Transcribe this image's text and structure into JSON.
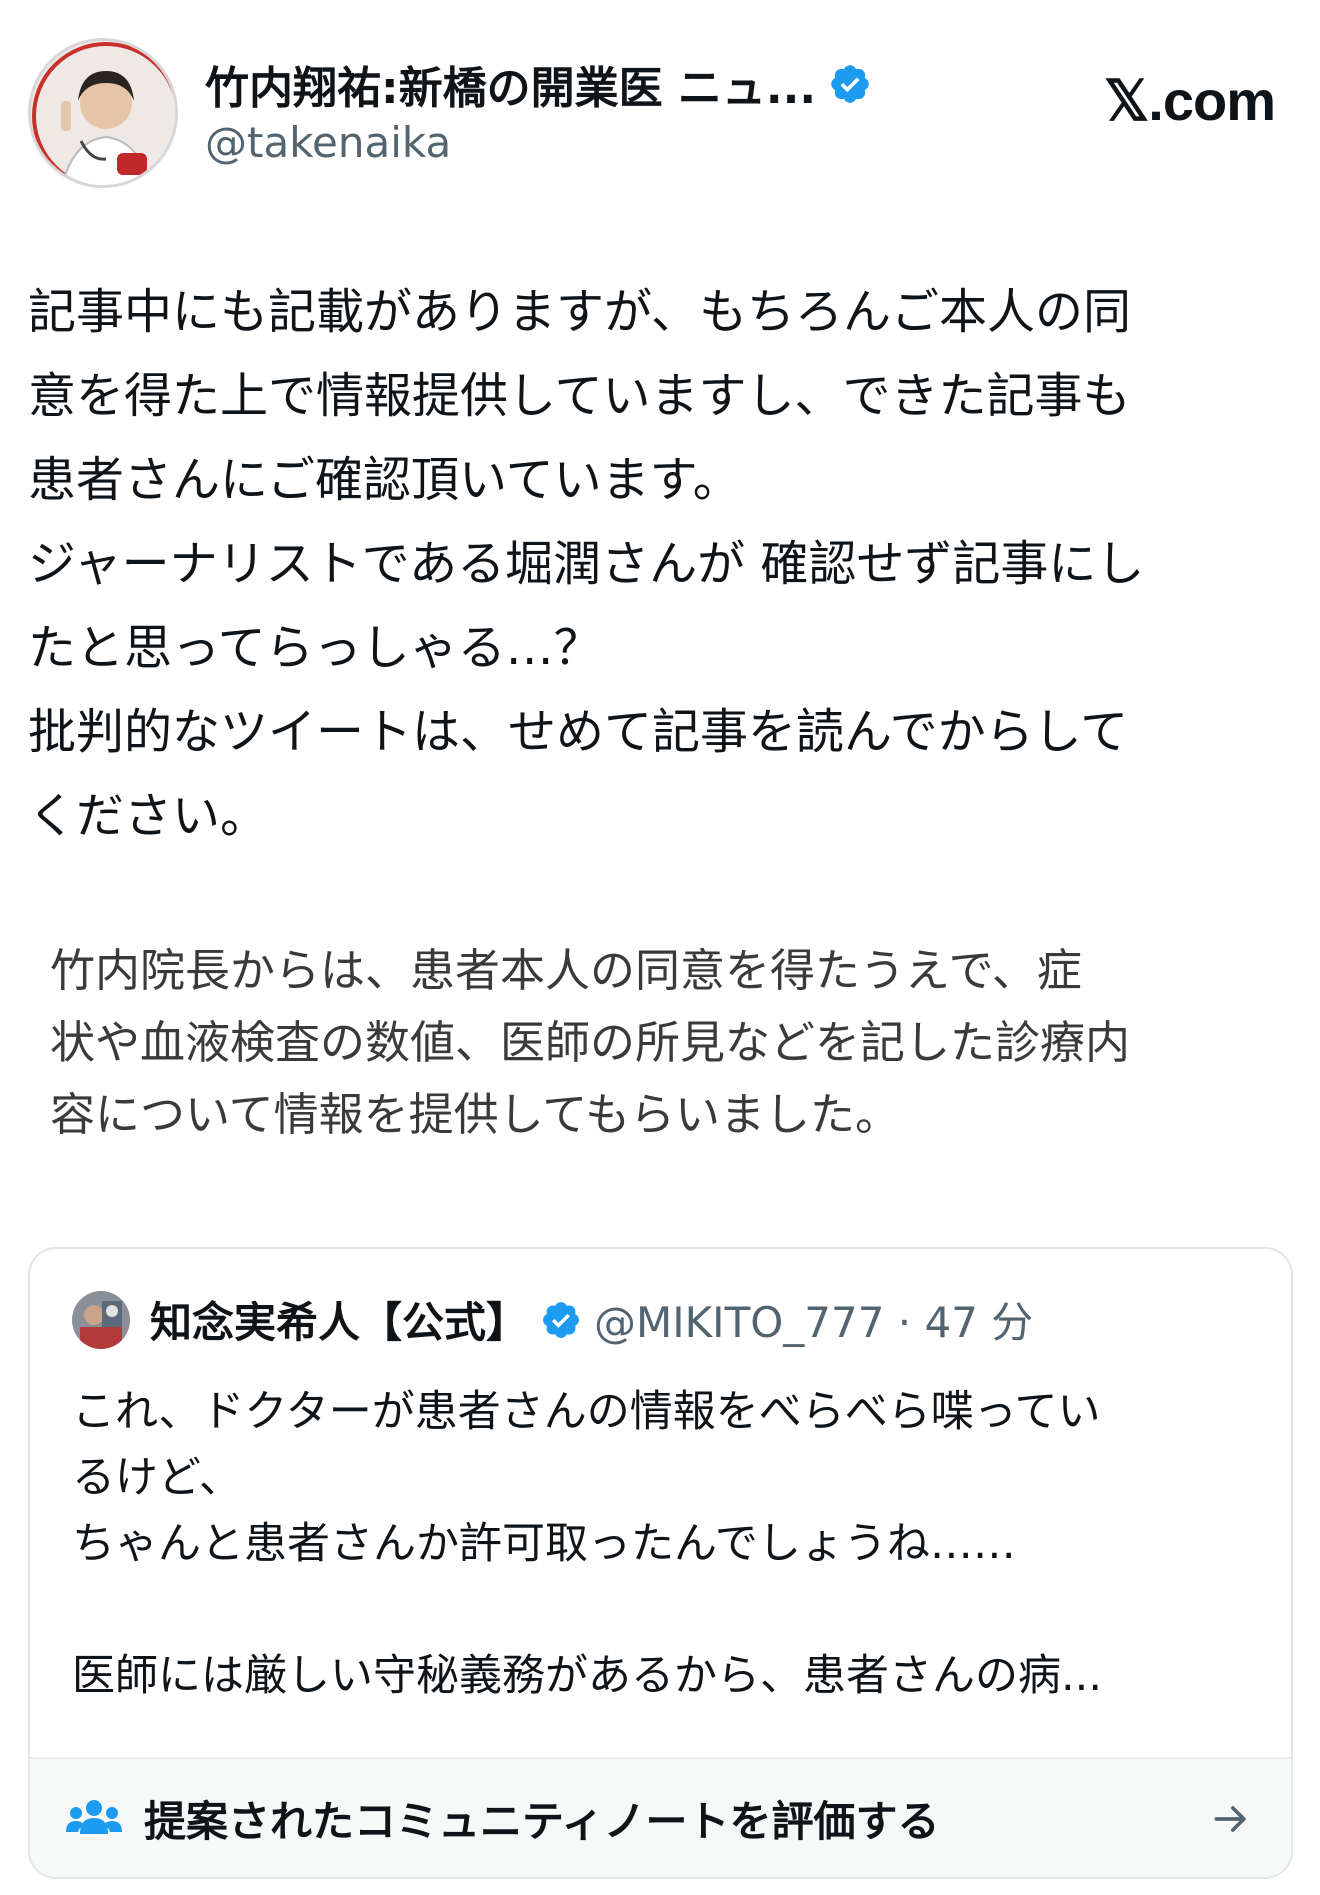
{
  "header": {
    "display_name": "竹内翔祐:新橋の開業医 ニュ...",
    "handle": "@takenaika",
    "site": "𝕏.com"
  },
  "post": {
    "lines": [
      "記事中にも記載がありますが、もちろんご本人の同",
      "意を得た上で情報提供していますし、できた記事も",
      "患者さんにご確認頂いています。",
      "ジャーナリストである堀潤さんが 確認せず記事にし",
      "たと思ってらっしゃる…？",
      "批判的なツイートは、せめて記事を読んでからして",
      "ください。"
    ]
  },
  "article_excerpt": {
    "lines": [
      "竹内院長からは、患者本人の同意を得たうえで、症",
      "状や血液検査の数値、医師の所見などを記した診療内",
      "容について情報を提供してもらいました。"
    ]
  },
  "quoted_post": {
    "name": "知念実希人【公式】",
    "handle": "@MIKITO_777 · 47 分",
    "lines": [
      "これ、ドクターが患者さんの情報をべらべら喋ってい",
      "るけど、",
      "ちゃんと患者さんか許可取ったんでしょうね……",
      "",
      "医師には厳しい守秘義務があるから、患者さんの病..."
    ]
  },
  "community_note": {
    "label": "提案されたコミュニティノートを評価する"
  },
  "colors": {
    "verified": "#1d9bf0",
    "text": "#0f1419",
    "secondary": "#536471"
  }
}
